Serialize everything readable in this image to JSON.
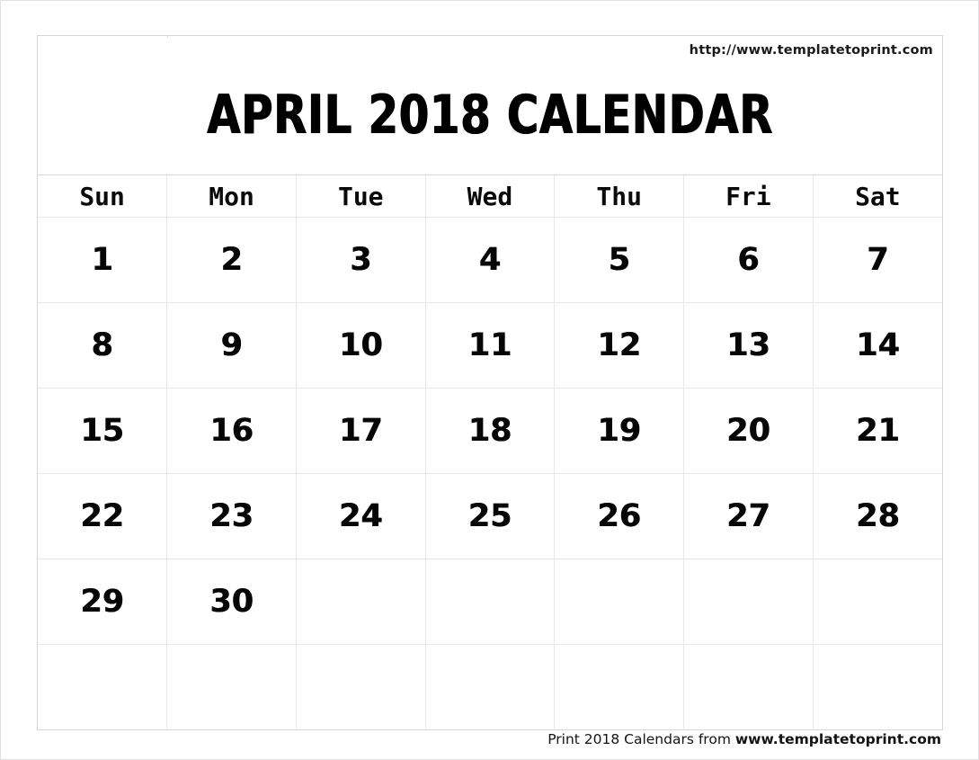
{
  "header": {
    "site_url": "http://www.templatetoprint.com",
    "title": "APRIL 2018 CALENDAR"
  },
  "calendar": {
    "month": "APRIL",
    "year": "2018",
    "weekday_headers": [
      "Sun",
      "Mon",
      "Tue",
      "Wed",
      "Thu",
      "Fri",
      "Sat"
    ],
    "weeks": [
      [
        "1",
        "2",
        "3",
        "4",
        "5",
        "6",
        "7"
      ],
      [
        "8",
        "9",
        "10",
        "11",
        "12",
        "13",
        "14"
      ],
      [
        "15",
        "16",
        "17",
        "18",
        "19",
        "20",
        "21"
      ],
      [
        "22",
        "23",
        "24",
        "25",
        "26",
        "27",
        "28"
      ],
      [
        "29",
        "30",
        "",
        "",
        "",
        "",
        ""
      ],
      [
        "",
        "",
        "",
        "",
        "",
        "",
        ""
      ]
    ]
  },
  "footer": {
    "lead_text": "Print 2018 Calendars from ",
    "site_text": "www.templatetoprint.com"
  },
  "colors": {
    "text": "#000000",
    "grid_line": "#e6e8ea",
    "outer_border": "#d4d7da",
    "page_border": "#dfe3e6",
    "background": "#ffffff"
  }
}
